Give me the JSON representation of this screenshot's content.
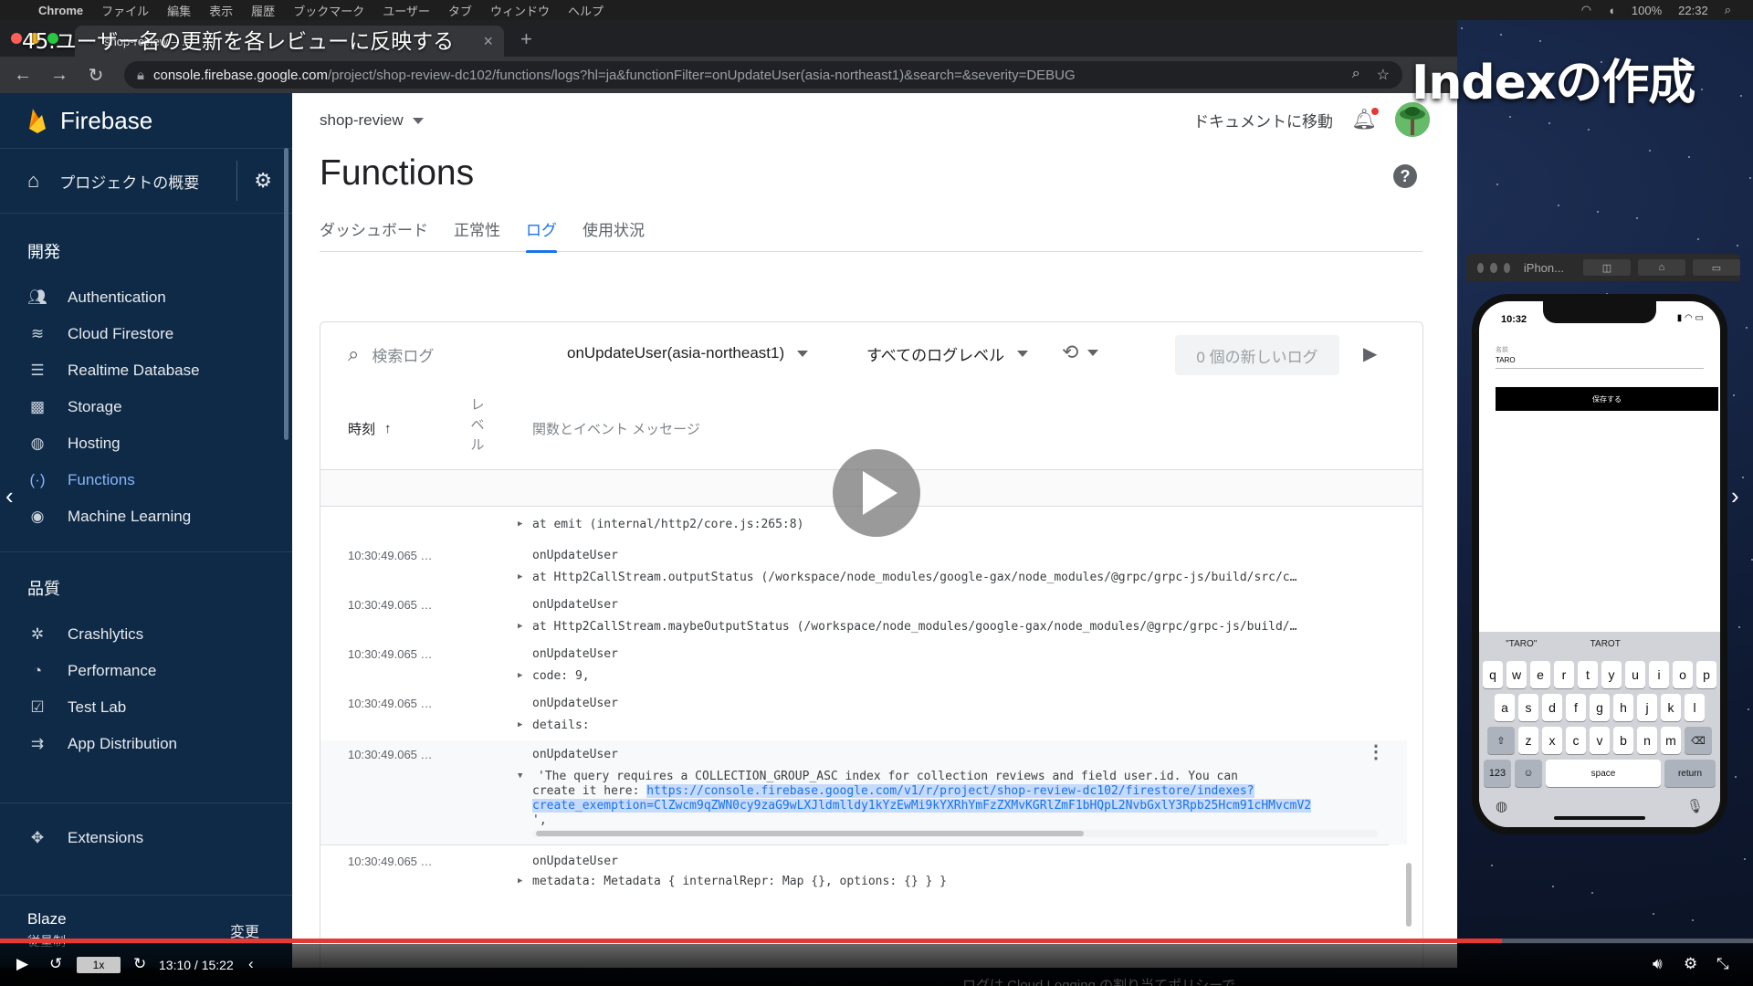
{
  "menubar": {
    "app": "Chrome",
    "items": [
      "ファイル",
      "編集",
      "表示",
      "履歴",
      "ブックマーク",
      "ユーザー",
      "タブ",
      "ウィンドウ",
      "ヘルプ"
    ],
    "battery": "100%",
    "time": "22:32"
  },
  "browser": {
    "tab_title": "shop-review – …",
    "url_host": "console.firebase.google.com",
    "url_path": "/project/shop-review-dc102/functions/logs?hl=ja&functionFilter=onUpdateUser(asia-northeast1)&search=&severity=DEBUG"
  },
  "video": {
    "lecture_title": "45.ユーザー名の更新を各レビューに反映する",
    "caption": "Indexの作成",
    "speed": "1x",
    "timecode": "13:10 / 15:22",
    "progress": 0.857,
    "subtitle": "ログは Cloud Logging の割り当てポリシーで..."
  },
  "sidebar": {
    "brand": "Firebase",
    "overview": "プロジェクトの概要",
    "sections": [
      {
        "title": "開発",
        "items": [
          {
            "label": "Authentication",
            "icon": "people-icon"
          },
          {
            "label": "Cloud Firestore",
            "icon": "firestore-icon"
          },
          {
            "label": "Realtime Database",
            "icon": "database-icon"
          },
          {
            "label": "Storage",
            "icon": "image-icon"
          },
          {
            "label": "Hosting",
            "icon": "globe-icon"
          },
          {
            "label": "Functions",
            "icon": "functions-icon",
            "active": true
          },
          {
            "label": "Machine Learning",
            "icon": "robot-icon"
          }
        ]
      },
      {
        "title": "品質",
        "items": [
          {
            "label": "Crashlytics",
            "icon": "crashlytics-icon"
          },
          {
            "label": "Performance",
            "icon": "gauge-icon"
          },
          {
            "label": "Test Lab",
            "icon": "checklist-icon"
          },
          {
            "label": "App Distribution",
            "icon": "distribution-icon"
          }
        ]
      }
    ],
    "extensions": "Extensions",
    "plan_name": "Blaze",
    "plan_sub": "従量制",
    "plan_change": "変更"
  },
  "header": {
    "project": "shop-review",
    "docs_link": "ドキュメントに移動",
    "page_title": "Functions",
    "help": "?"
  },
  "tabs": [
    "ダッシュボード",
    "正常性",
    "ログ",
    "使用状況"
  ],
  "filters": {
    "search_placeholder": "検索ログ",
    "function": "onUpdateUser(asia-northeast1)",
    "level": "すべてのログレベル",
    "new_logs": "0 個の新しいログ"
  },
  "columns": {
    "time": "時刻",
    "level": "レベル",
    "message": "関数とイベント メッセージ"
  },
  "logs": [
    {
      "ts": "",
      "fn": "",
      "payload": "at emit (internal/http2/core.js:265:8)"
    },
    {
      "ts": "10:30:49.065 …",
      "fn": "onUpdateUser",
      "payload": "at Http2CallStream.outputStatus (/workspace/node_modules/google-gax/node_modules/@grpc/grpc-js/build/src/c…"
    },
    {
      "ts": "10:30:49.065 …",
      "fn": "onUpdateUser",
      "payload": "at Http2CallStream.maybeOutputStatus (/workspace/node_modules/google-gax/node_modules/@grpc/grpc-js/build/…"
    },
    {
      "ts": "10:30:49.065 …",
      "fn": "onUpdateUser",
      "payload": "code: 9,"
    },
    {
      "ts": "10:30:49.065 …",
      "fn": "onUpdateUser",
      "payload": "details:"
    },
    {
      "ts": "10:30:49.065 …",
      "fn": "onUpdateUser",
      "line1": "'The query requires a COLLECTION_GROUP_ASC index for collection reviews and field user.id. You can",
      "line2_plain": "create it here: ",
      "line2_link": "https://console.firebase.google.com/v1/r/project/shop-review-dc102/firestore/indexes?",
      "line3_link": "create_exemption=ClZwcm9qZWN0cy9zaG9wLXJldmlldy1kYzEwMi9kYXRhYmFzZXMvKGRlZmF1bHQpL2NvbGxlY3Rpb25Hcm91cHMvcmV2",
      "line4": "',"
    },
    {
      "ts": "10:30:49.065 …",
      "fn": "onUpdateUser",
      "payload": "metadata: Metadata { internalRepr: Map {}, options: {} } }"
    }
  ],
  "phone": {
    "window_title": "iPhon...",
    "clock": "10:32",
    "name_label": "名前",
    "name_value": "TARO",
    "save_button": "保存する",
    "suggestions": [
      "\"TARO\"",
      "TAROT"
    ],
    "row1": [
      "q",
      "w",
      "e",
      "r",
      "t",
      "y",
      "u",
      "i",
      "o",
      "p"
    ],
    "row2": [
      "a",
      "s",
      "d",
      "f",
      "g",
      "h",
      "j",
      "k",
      "l"
    ],
    "row3": [
      "z",
      "x",
      "c",
      "v",
      "b",
      "n",
      "m"
    ],
    "key_123": "123",
    "key_space": "space",
    "key_return": "return"
  },
  "colors": {
    "sidebar_bg": "#0e2a47",
    "accent": "#1a73e8",
    "progress": "#e53935"
  }
}
